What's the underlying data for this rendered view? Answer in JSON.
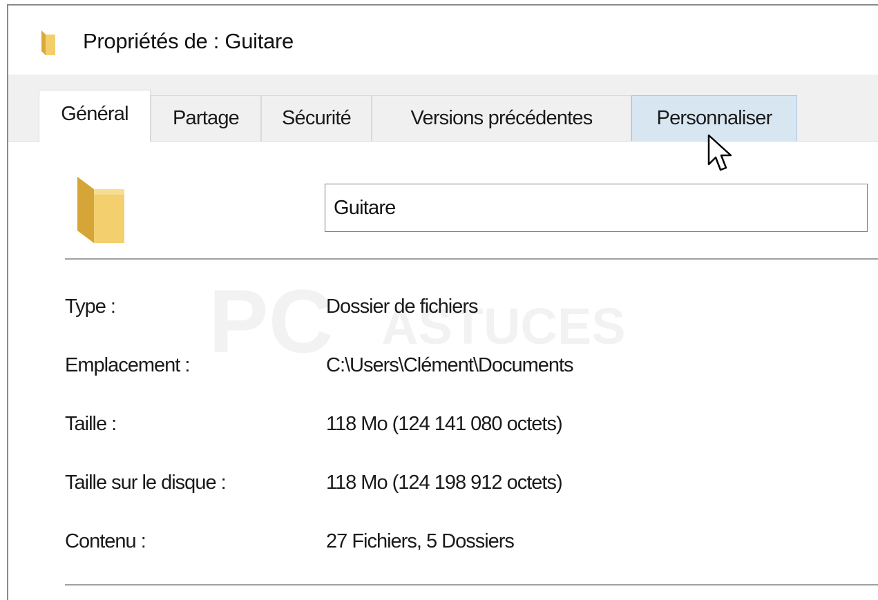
{
  "window": {
    "title": "Propriétés de : Guitare"
  },
  "tabs": [
    {
      "label": "Général"
    },
    {
      "label": "Partage"
    },
    {
      "label": "Sécurité"
    },
    {
      "label": "Versions précédentes"
    },
    {
      "label": "Personnaliser"
    }
  ],
  "general": {
    "folder_name_value": "Guitare",
    "properties": [
      {
        "label": "Type :",
        "value": "Dossier de fichiers"
      },
      {
        "label": "Emplacement :",
        "value": "C:\\Users\\Clément\\Documents"
      },
      {
        "label": "Taille :",
        "value": "118 Mo (124 141 080 octets)"
      },
      {
        "label": "Taille sur le disque :",
        "value": "118 Mo (124 198 912 octets)"
      },
      {
        "label": "Contenu :",
        "value": "27 Fichiers, 5 Dossiers"
      }
    ]
  },
  "watermark": {
    "brand_big": "PC",
    "brand_small": "ASTUCES"
  },
  "colors": {
    "folder": "#e8c35c",
    "tab_hover": "#d8e6f2",
    "dialog_bg": "#f0f0f0"
  }
}
